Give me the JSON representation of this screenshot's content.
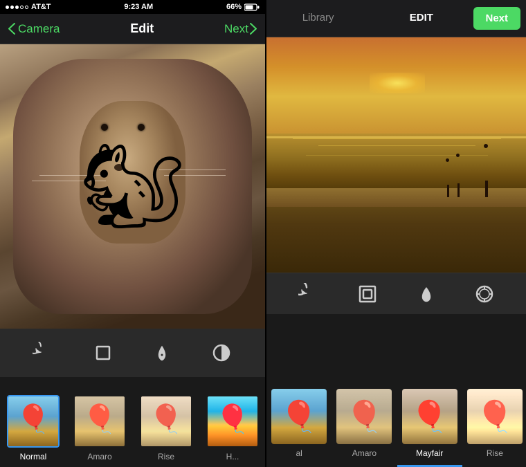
{
  "left": {
    "status": {
      "carrier": "AT&T",
      "time": "9:23 AM",
      "battery": "66%"
    },
    "nav": {
      "back_label": "Camera",
      "title": "Edit",
      "next_label": "Next"
    },
    "tools": [
      {
        "name": "rotate",
        "label": "Rotate"
      },
      {
        "name": "crop",
        "label": "Crop"
      },
      {
        "name": "brightness",
        "label": "Brightness"
      },
      {
        "name": "contrast",
        "label": "Contrast"
      }
    ],
    "filters": [
      {
        "id": "normal",
        "label": "Normal",
        "active": true
      },
      {
        "id": "amaro",
        "label": "Amaro",
        "active": false
      },
      {
        "id": "rise",
        "label": "Rise",
        "active": false
      },
      {
        "id": "hudson",
        "label": "H...",
        "active": false
      }
    ]
  },
  "right": {
    "tabs": [
      {
        "id": "library",
        "label": "Library"
      },
      {
        "id": "edit",
        "label": "EDIT",
        "active": true
      }
    ],
    "next_label": "Next",
    "tools": [
      {
        "name": "history",
        "label": "History"
      },
      {
        "name": "frame",
        "label": "Frame"
      },
      {
        "name": "lux",
        "label": "Lux"
      },
      {
        "name": "adjust",
        "label": "Adjust"
      }
    ],
    "filters": [
      {
        "id": "normal2",
        "label": "al",
        "active": false
      },
      {
        "id": "amaro2",
        "label": "Amaro",
        "active": false
      },
      {
        "id": "mayfair",
        "label": "Mayfair",
        "active": true
      },
      {
        "id": "rise2",
        "label": "Rise",
        "active": false
      }
    ]
  }
}
